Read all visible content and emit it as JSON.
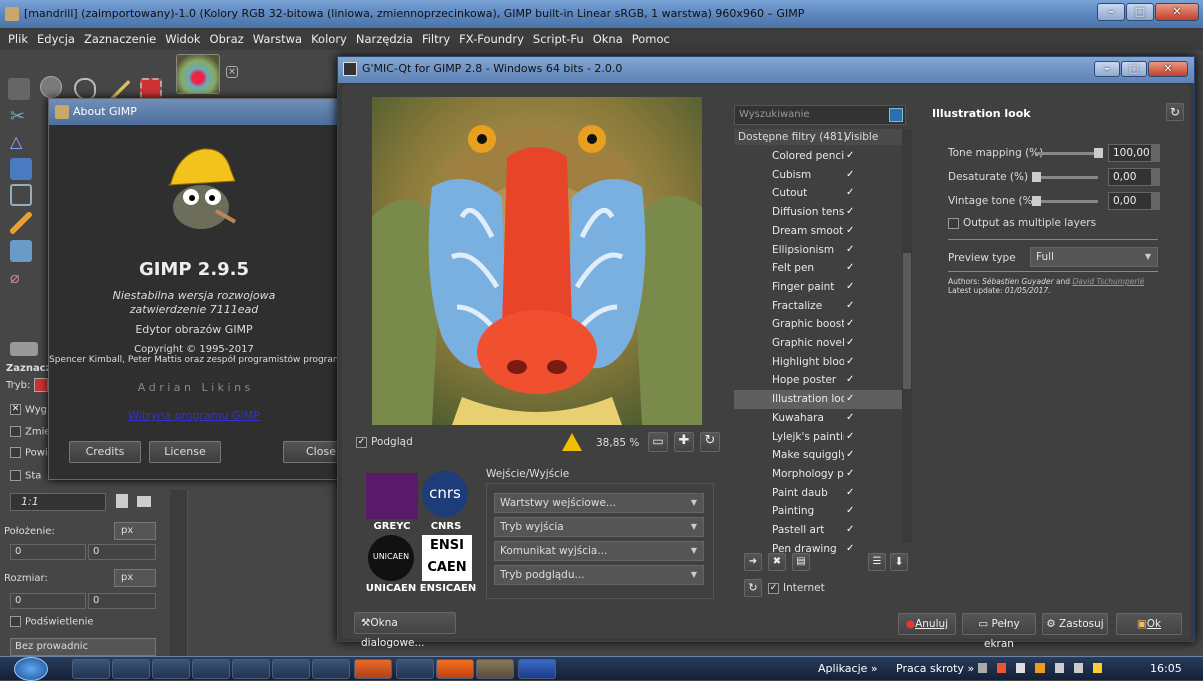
{
  "gimp": {
    "title": "[mandrill] (zaimportowany)-1.0 (Kolory RGB 32-bitowa (liniowa, zmiennoprzecinkowa), GIMP built-in Linear sRGB, 1 warstwa) 960x960 – GIMP",
    "menu": [
      "Plik",
      "Edycja",
      "Zaznaczenie",
      "Widok",
      "Obraz",
      "Warstwa",
      "Kolory",
      "Narzędzia",
      "Filtry",
      "FX-Foundry",
      "Script-Fu",
      "Okna",
      "Pomoc"
    ],
    "tool_options": {
      "title": "Zaznaczenie",
      "mode_label": "Tryb:",
      "items": [
        "Wyg",
        "Zmie",
        "Powi",
        "Sta"
      ],
      "ratio_value": "1:1",
      "position_label": "Położenie:",
      "size_label": "Rozmiar:",
      "unit": "px",
      "zero": "0",
      "highlight": "Podświetlenie",
      "guides": "Bez prowadnic"
    }
  },
  "about": {
    "title": "About GIMP",
    "app": "GIMP 2.9.5",
    "subtitle": "Niestabilna wersja rozwojowa",
    "commit": "zatwierdzenie 7111ead",
    "editor": "Edytor obrazów GIMP",
    "copyright": "Copyright © 1995-2017",
    "authors": "Spencer Kimball, Peter Mattis oraz zespół programistów programu",
    "credit_name": "A d r i a n   L i k i n s",
    "website": "Witryna programu GIMP",
    "buttons": [
      "Credits",
      "License",
      "Close"
    ]
  },
  "gmic": {
    "title": "G'MIC-Qt for GIMP 2.8 - Windows 64 bits - 2.0.0",
    "preview_label": "Podgląd",
    "zoom": "38,85 %",
    "io": {
      "title": "Wejście/Wyjście",
      "dropdowns": [
        "Wartstwy wejściowe...",
        "Tryb wyjścia",
        "Komunikat wyjścia...",
        "Tryb podglądu..."
      ]
    },
    "logos": [
      "GREYC",
      "CNRS",
      "UNICAEN",
      "ENSICAEN"
    ],
    "search_placeholder": "Wyszukiwanie",
    "list_header": "Dostępne filtry (481)",
    "visible_header": "Visible",
    "filters": [
      {
        "name": "Colored pencils",
        "selected": false
      },
      {
        "name": "Cubism",
        "selected": false
      },
      {
        "name": "Cutout",
        "selected": false
      },
      {
        "name": "Diffusion tensors",
        "selected": false
      },
      {
        "name": "Dream smoothing",
        "selected": false
      },
      {
        "name": "Ellipsionism",
        "selected": false
      },
      {
        "name": "Felt pen",
        "selected": false
      },
      {
        "name": "Finger paint",
        "selected": false
      },
      {
        "name": "Fractalize",
        "selected": false
      },
      {
        "name": "Graphic boost",
        "selected": false
      },
      {
        "name": "Graphic novel",
        "selected": false
      },
      {
        "name": "Highlight bloom",
        "selected": false
      },
      {
        "name": "Hope poster",
        "selected": false
      },
      {
        "name": "Illustration look",
        "selected": true
      },
      {
        "name": "Kuwahara",
        "selected": false
      },
      {
        "name": "Lylejk's painting",
        "selected": false
      },
      {
        "name": "Make squiggly",
        "selected": false
      },
      {
        "name": "Morphology pain",
        "selected": false
      },
      {
        "name": "Paint daub",
        "selected": false
      },
      {
        "name": "Painting",
        "selected": false
      },
      {
        "name": "Pastell art",
        "selected": false
      },
      {
        "name": "Pen drawing",
        "selected": false
      }
    ],
    "check": "✓",
    "internet": "Internet",
    "params": {
      "title": "Illustration look",
      "sliders": [
        {
          "label": "Tone mapping (%)",
          "value": "100,00",
          "fraction": 1.0
        },
        {
          "label": "Desaturate (%)",
          "value": "0,00",
          "fraction": 0.0
        },
        {
          "label": "Vintage tone (%)",
          "value": "0,00",
          "fraction": 0.0
        }
      ],
      "multi_layers": "Output as multiple layers",
      "preview_type_label": "Preview type",
      "preview_type_value": "Full",
      "authors_prefix": "Authors:",
      "author1": "Sébastien Guyader",
      "and": "and",
      "author2": "David Tschumperlé",
      "update_prefix": "Latest update:",
      "update_date": "01/05/2017."
    },
    "buttons": {
      "dialogs": "Okna dialogowe...",
      "cancel": "Anuluj",
      "fullscreen": "Pełny ekran",
      "apply": "Zastosuj",
      "ok": "Ok"
    }
  },
  "taskbar": {
    "apps_label": "Aplikacje",
    "shortcuts_label": "Praca skroty",
    "chevron": "»",
    "time": "16:05"
  }
}
